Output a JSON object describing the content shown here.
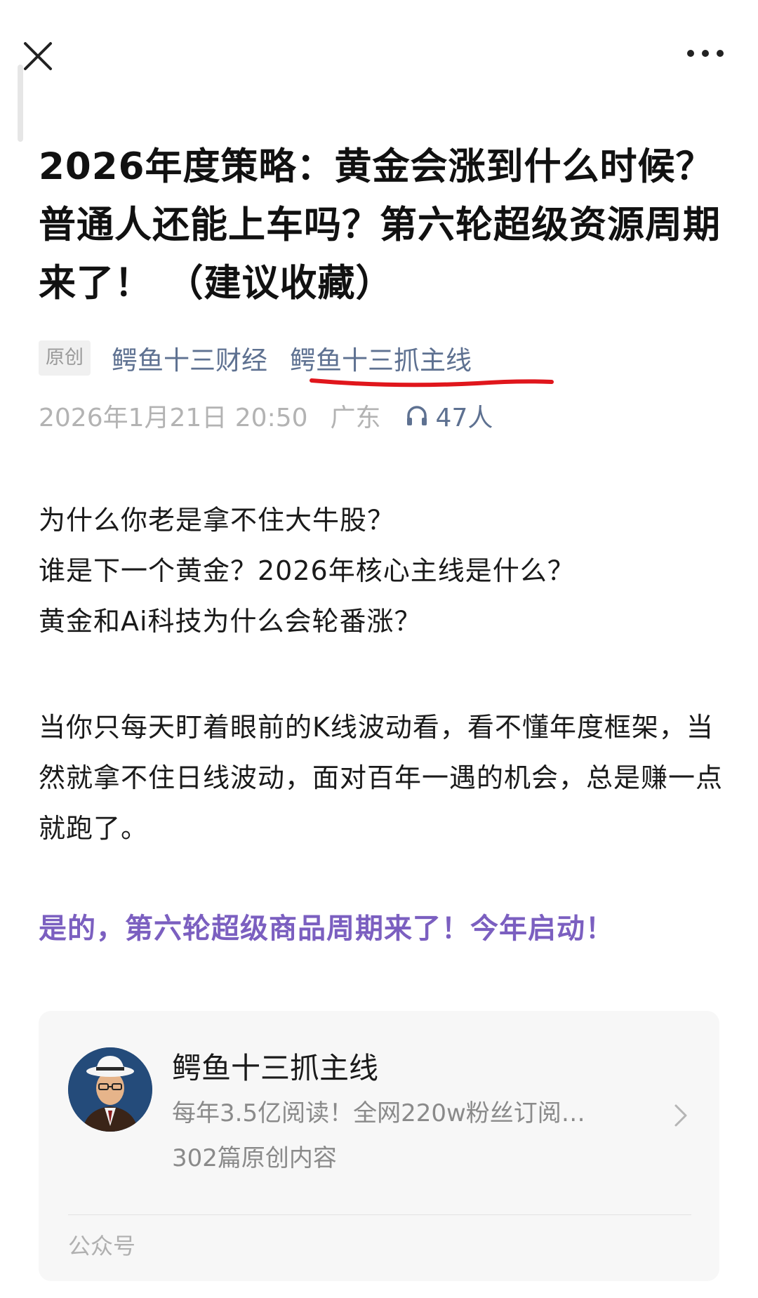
{
  "header": {
    "close_icon": "close-icon",
    "more_icon": "more-dots-icon"
  },
  "article": {
    "title": "2026年度策略：黄金会涨到什么时候？普通人还能上车吗？第六轮超级资源周期来了！ （建议收藏）",
    "original_tag": "原创",
    "account_primary": "鳄鱼十三财经",
    "account_secondary": "鳄鱼十三抓主线",
    "date": "2026年1月21日 20:50",
    "location": "广东",
    "listeners": "47人",
    "listen_icon": "headphones-icon",
    "paragraph1": "为什么你老是拿不住大牛股？\n谁是下一个黄金？2026年核心主线是什么？\n黄金和Ai科技为什么会轮番涨？",
    "paragraph2": "当你只每天盯着眼前的K线波动看，看不懂年度框架，当然就拿不住日线波动，面对百年一遇的机会，总是赚一点就跑了。",
    "highlight": "是的，第六轮超级商品周期来了！今年启动！"
  },
  "profile_card": {
    "name": "鳄鱼十三抓主线",
    "description": "每年3.5亿阅读！全网220w粉丝订阅…",
    "count": "302篇原创内容",
    "type": "公众号",
    "chevron_icon": "chevron-right-icon"
  },
  "colors": {
    "link": "#5e7191",
    "highlight": "#7b5fc0",
    "underline": "#e0161c"
  }
}
